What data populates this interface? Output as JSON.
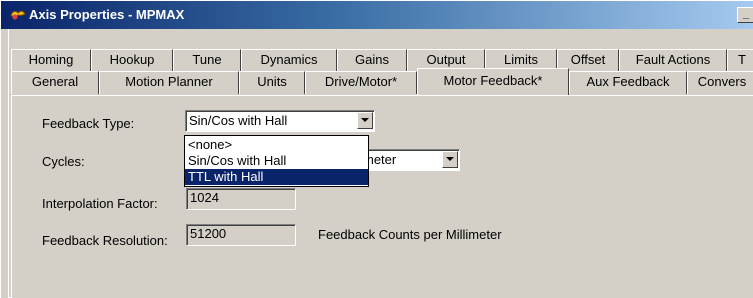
{
  "window": {
    "title": "Axis Properties - MPMAX",
    "minimize_glyph": "_"
  },
  "tabs": {
    "row_back": [
      {
        "label": "Homing"
      },
      {
        "label": "Hookup"
      },
      {
        "label": "Tune"
      },
      {
        "label": "Dynamics"
      },
      {
        "label": "Gains"
      },
      {
        "label": "Output"
      },
      {
        "label": "Limits"
      },
      {
        "label": "Offset"
      },
      {
        "label": "Fault Actions"
      },
      {
        "label": "T"
      }
    ],
    "row_front": [
      {
        "label": "General"
      },
      {
        "label": "Motion Planner"
      },
      {
        "label": "Units"
      },
      {
        "label": "Drive/Motor*"
      },
      {
        "label": "Motor Feedback*"
      },
      {
        "label": "Aux Feedback"
      },
      {
        "label": "Convers"
      }
    ],
    "active": "Motor Feedback*"
  },
  "form": {
    "feedback_type_label": "Feedback Type:",
    "feedback_type_value": "Sin/Cos with Hall",
    "cycles_label": "Cycles:",
    "cycles_unit_value": "meter",
    "interpolation_label": "Interpolation Factor:",
    "interpolation_value": "1024",
    "resolution_label": "Feedback Resolution:",
    "resolution_value": "51200",
    "resolution_units": "Feedback Counts per Millimeter"
  },
  "dropdown": {
    "options": [
      "<none>",
      "Sin/Cos with Hall",
      "TTL with Hall"
    ],
    "highlighted": "TTL with Hall"
  }
}
